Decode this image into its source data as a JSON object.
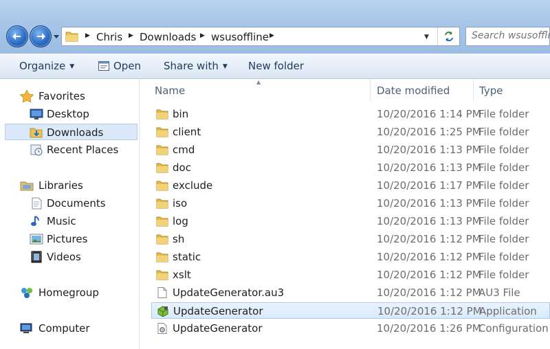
{
  "address": {
    "crumbs": [
      "Chris",
      "Downloads",
      "wsusoffline"
    ]
  },
  "search": {
    "placeholder": "Search wsusoffline"
  },
  "toolbar": {
    "organize": "Organize",
    "open": "Open",
    "share_with": "Share with",
    "new_folder": "New folder"
  },
  "nav": {
    "favorites": "Favorites",
    "desktop": "Desktop",
    "downloads": "Downloads",
    "recent_places": "Recent Places",
    "libraries": "Libraries",
    "documents": "Documents",
    "music": "Music",
    "pictures": "Pictures",
    "videos": "Videos",
    "homegroup": "Homegroup",
    "computer": "Computer"
  },
  "columns": {
    "name": "Name",
    "date_modified": "Date modified",
    "type": "Type"
  },
  "files": [
    {
      "name": "bin",
      "date": "10/20/2016 1:14 PM",
      "type": "File folder",
      "icon": "folder-icon"
    },
    {
      "name": "client",
      "date": "10/20/2016 1:25 PM",
      "type": "File folder",
      "icon": "folder-icon"
    },
    {
      "name": "cmd",
      "date": "10/20/2016 1:13 PM",
      "type": "File folder",
      "icon": "folder-icon"
    },
    {
      "name": "doc",
      "date": "10/20/2016 1:13 PM",
      "type": "File folder",
      "icon": "folder-icon"
    },
    {
      "name": "exclude",
      "date": "10/20/2016 1:17 PM",
      "type": "File folder",
      "icon": "folder-icon"
    },
    {
      "name": "iso",
      "date": "10/20/2016 1:13 PM",
      "type": "File folder",
      "icon": "folder-icon"
    },
    {
      "name": "log",
      "date": "10/20/2016 1:13 PM",
      "type": "File folder",
      "icon": "folder-icon"
    },
    {
      "name": "sh",
      "date": "10/20/2016 1:12 PM",
      "type": "File folder",
      "icon": "folder-icon"
    },
    {
      "name": "static",
      "date": "10/20/2016 1:12 PM",
      "type": "File folder",
      "icon": "folder-icon"
    },
    {
      "name": "xslt",
      "date": "10/20/2016 1:12 PM",
      "type": "File folder",
      "icon": "folder-icon"
    },
    {
      "name": "UpdateGenerator.au3",
      "date": "10/20/2016 1:12 PM",
      "type": "AU3 File",
      "icon": "document-icon"
    },
    {
      "name": "UpdateGenerator",
      "date": "10/20/2016 1:12 PM",
      "type": "Application",
      "icon": "application-icon"
    },
    {
      "name": "UpdateGenerator",
      "date": "10/20/2016 1:26 PM",
      "type": "Configuration se",
      "icon": "config-file-icon"
    }
  ]
}
